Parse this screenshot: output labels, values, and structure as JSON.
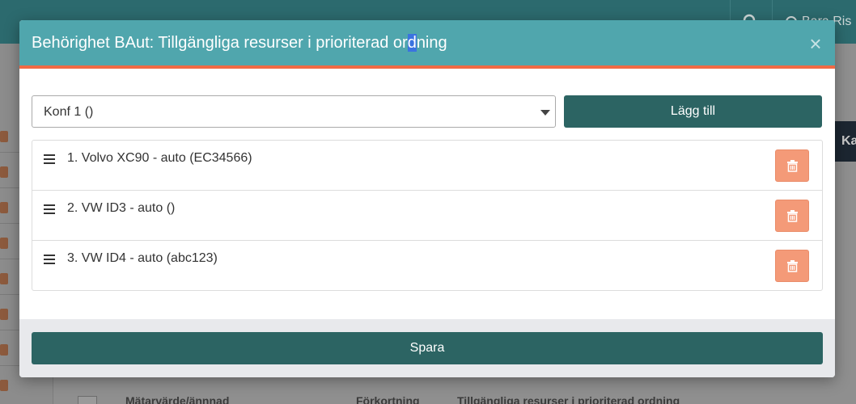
{
  "background": {
    "user_name": "Bara Ris",
    "side_button": "Ka",
    "bottom_columns": [
      "Mätarvärde/ännnad",
      "Förkortning",
      "Tillgängliga resurser i prioriterad ordning"
    ]
  },
  "modal": {
    "title_before": "Behörighet BAut: Tillgängliga resurser i prioriterad or",
    "title_selected": "d",
    "title_after": "ning",
    "close_label": "×",
    "select_value": "Konf 1 ()",
    "add_label": "Lägg till",
    "items": [
      {
        "label": "1. Volvo XC90 - auto (EC34566)"
      },
      {
        "label": "2. VW ID3 - auto ()"
      },
      {
        "label": "3. VW ID4 - auto (abc123)"
      }
    ],
    "save_label": "Spara"
  },
  "colors": {
    "header": "#50a6ad",
    "header_accent": "#f06a45",
    "primary_button": "#2c6463",
    "delete_button": "#f49a78"
  }
}
